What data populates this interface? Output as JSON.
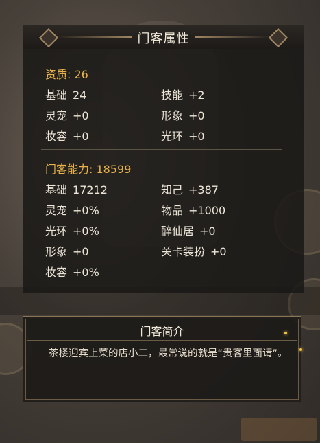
{
  "window": {
    "title": "门客属性"
  },
  "aptitude": {
    "header": "资质: 26",
    "rows": [
      {
        "label": "基础",
        "value": "24"
      },
      {
        "label": "技能",
        "value": "+2"
      },
      {
        "label": "灵宠",
        "value": "+0"
      },
      {
        "label": "形象",
        "value": "+0"
      },
      {
        "label": "妆容",
        "value": "+0"
      },
      {
        "label": "光环",
        "value": "+0"
      }
    ]
  },
  "ability": {
    "header": "门客能力: 18599",
    "rows": [
      {
        "label": "基础",
        "value": "17212"
      },
      {
        "label": "知己",
        "value": "+387"
      },
      {
        "label": "灵宠",
        "value": "+0%"
      },
      {
        "label": "物品",
        "value": "+1000"
      },
      {
        "label": "光环",
        "value": "+0%"
      },
      {
        "label": "醉仙居",
        "value": "+0"
      },
      {
        "label": "形象",
        "value": "+0"
      },
      {
        "label": "关卡装扮",
        "value": "+0"
      },
      {
        "label": "妆容",
        "value": "+0%"
      }
    ]
  },
  "intro": {
    "title": "门客简介",
    "text": "茶楼迎宾上菜的店小二，最常说的就是“贵客里面请”。"
  },
  "colors": {
    "gold": "#e9b24b",
    "text": "#ede6d8",
    "frame": "#8a7458"
  }
}
